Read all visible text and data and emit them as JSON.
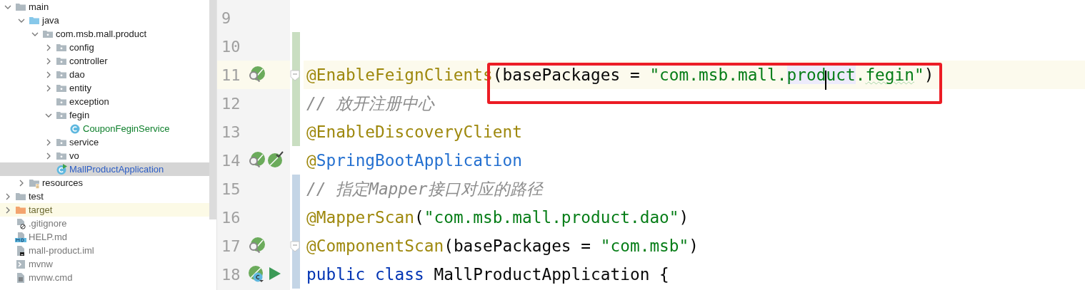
{
  "project_tree": {
    "items": [
      {
        "name": "main",
        "kind": "folder",
        "expanded": true,
        "selected": false,
        "children": [
          {
            "name": "java",
            "kind": "source-folder",
            "expanded": true,
            "selected": false,
            "children": [
              {
                "name": "com.msb.mall.product",
                "kind": "package",
                "expanded": true,
                "selected": false,
                "children": [
                  {
                    "name": "config",
                    "kind": "package",
                    "expanded": false,
                    "selected": false
                  },
                  {
                    "name": "controller",
                    "kind": "package",
                    "expanded": false,
                    "selected": false
                  },
                  {
                    "name": "dao",
                    "kind": "package",
                    "expanded": false,
                    "selected": false
                  },
                  {
                    "name": "entity",
                    "kind": "package",
                    "expanded": false,
                    "selected": false
                  },
                  {
                    "name": "exception",
                    "kind": "package",
                    "selected": false
                  },
                  {
                    "name": "fegin",
                    "kind": "package",
                    "expanded": true,
                    "selected": false,
                    "children": [
                      {
                        "name": "CouponFeginService",
                        "kind": "class",
                        "color": "#0d7f2b",
                        "selected": false
                      }
                    ]
                  },
                  {
                    "name": "service",
                    "kind": "package",
                    "expanded": false,
                    "selected": false
                  },
                  {
                    "name": "vo",
                    "kind": "package",
                    "expanded": false,
                    "selected": false
                  },
                  {
                    "name": "MallProductApplication",
                    "kind": "run-class",
                    "color": "#2b5cc4",
                    "selected": true
                  }
                ]
              }
            ]
          },
          {
            "name": "resources",
            "kind": "resources-folder",
            "expanded": false,
            "selected": false
          }
        ]
      },
      {
        "name": "test",
        "kind": "folder",
        "expanded": false,
        "selected": false
      },
      {
        "name": "target",
        "kind": "excluded-folder",
        "color": "#6d6a33",
        "expanded": false,
        "selected": false
      },
      {
        "name": ".gitignore",
        "kind": "ignore-file",
        "color": "#777777",
        "selected": false
      },
      {
        "name": "HELP.md",
        "kind": "markdown-file",
        "color": "#777777",
        "selected": false
      },
      {
        "name": "mall-product.iml",
        "kind": "module-file",
        "color": "#777777",
        "selected": false
      },
      {
        "name": "mvnw",
        "kind": "script-file",
        "color": "#777777",
        "selected": false
      },
      {
        "name": "mvnw.cmd",
        "kind": "text-file",
        "color": "#777777",
        "selected": false
      }
    ]
  },
  "editor": {
    "lines": [
      {
        "number": "9",
        "current": false
      },
      {
        "number": "10",
        "color": "#c9dec1",
        "current": false
      },
      {
        "number": "11",
        "color": "#c9dec1",
        "current": true,
        "fold": true,
        "gutter_icons": [
          {
            "kind": "bean-find"
          }
        ],
        "tokens": [
          {
            "text": "@EnableFeignClients",
            "kind": "annotation"
          },
          {
            "kind": "frame",
            "tokens": [
              {
                "text": "(basePackages = ",
                "kind": "plain"
              },
              {
                "text": "\"com.msb.mall.",
                "kind": "string"
              },
              {
                "text": "prod",
                "kind": "string",
                "highlighted": true,
                "caret_after": true
              },
              {
                "text": "uct",
                "kind": "string",
                "highlighted": true
              },
              {
                "text": ".",
                "kind": "string"
              },
              {
                "text": "fegin",
                "kind": "string",
                "typo": true
              },
              {
                "text": "\"",
                "kind": "string"
              },
              {
                "text": ")",
                "kind": "plain"
              }
            ]
          }
        ]
      },
      {
        "number": "12",
        "color": "#c9dec1",
        "current": false,
        "tokens": [
          {
            "text": "// 放开注册中心",
            "kind": "comment"
          }
        ]
      },
      {
        "number": "13",
        "color": "#c9dec1",
        "current": false,
        "tokens": [
          {
            "text": "@EnableDiscoveryClient",
            "kind": "annotation"
          }
        ]
      },
      {
        "number": "14",
        "current": false,
        "gutter_icons": [
          {
            "kind": "bean-find"
          },
          {
            "kind": "bean-check"
          }
        ],
        "tokens": [
          {
            "text": "@",
            "kind": "annotation"
          },
          {
            "text": "SpringBootApplication",
            "kind": "reference"
          }
        ]
      },
      {
        "number": "15",
        "color": "#c4d5e6",
        "current": false,
        "tokens": [
          {
            "text": "// 指定Mapper接口对应的路径",
            "kind": "comment"
          }
        ]
      },
      {
        "number": "16",
        "color": "#c4d5e6",
        "current": false,
        "tokens": [
          {
            "text": "@MapperScan",
            "kind": "annotation"
          },
          {
            "text": "(",
            "kind": "plain"
          },
          {
            "text": "\"com.msb.mall.product.dao\"",
            "kind": "string"
          },
          {
            "text": ")",
            "kind": "plain"
          }
        ]
      },
      {
        "number": "17",
        "color": "#c4d5e6",
        "current": false,
        "fold": true,
        "gutter_icons": [
          {
            "kind": "bean-find"
          }
        ],
        "tokens": [
          {
            "text": "@ComponentScan",
            "kind": "annotation"
          },
          {
            "text": "(basePackages = ",
            "kind": "plain"
          },
          {
            "text": "\"com.msb\"",
            "kind": "string"
          },
          {
            "text": ")",
            "kind": "plain"
          }
        ]
      },
      {
        "number": "18",
        "color": "#c4d5e6",
        "current": false,
        "gutter_icons": [
          {
            "kind": "bean-class"
          },
          {
            "kind": "run"
          }
        ],
        "tokens": [
          {
            "text": "public class ",
            "kind": "keyword"
          },
          {
            "text": "MallProductApplication {",
            "kind": "plain"
          }
        ]
      }
    ]
  }
}
